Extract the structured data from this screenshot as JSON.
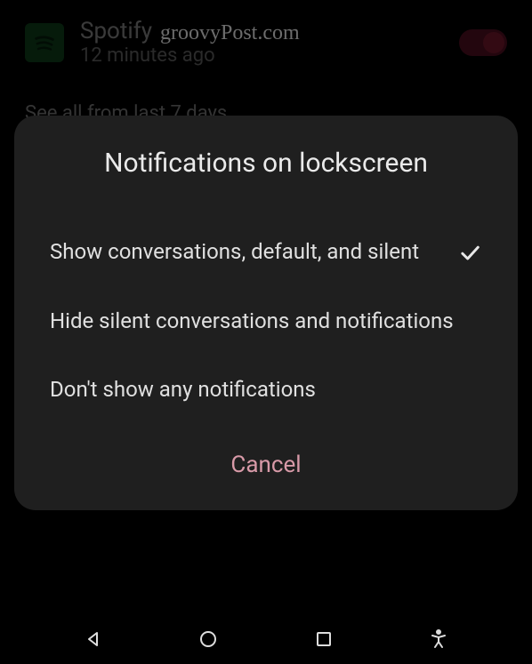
{
  "notification": {
    "app_name": "Spotify",
    "timestamp": "12 minutes ago",
    "toggle_on": true,
    "truncated_row": "See all from last 7 days"
  },
  "watermark": "groovyPost.com",
  "dialog": {
    "title": "Notifications on lockscreen",
    "options": [
      {
        "label": "Show conversations, default, and silent",
        "selected": true
      },
      {
        "label": "Hide silent conversations and notifications",
        "selected": false
      },
      {
        "label": "Don't show any notifications",
        "selected": false
      }
    ],
    "cancel": "Cancel"
  }
}
